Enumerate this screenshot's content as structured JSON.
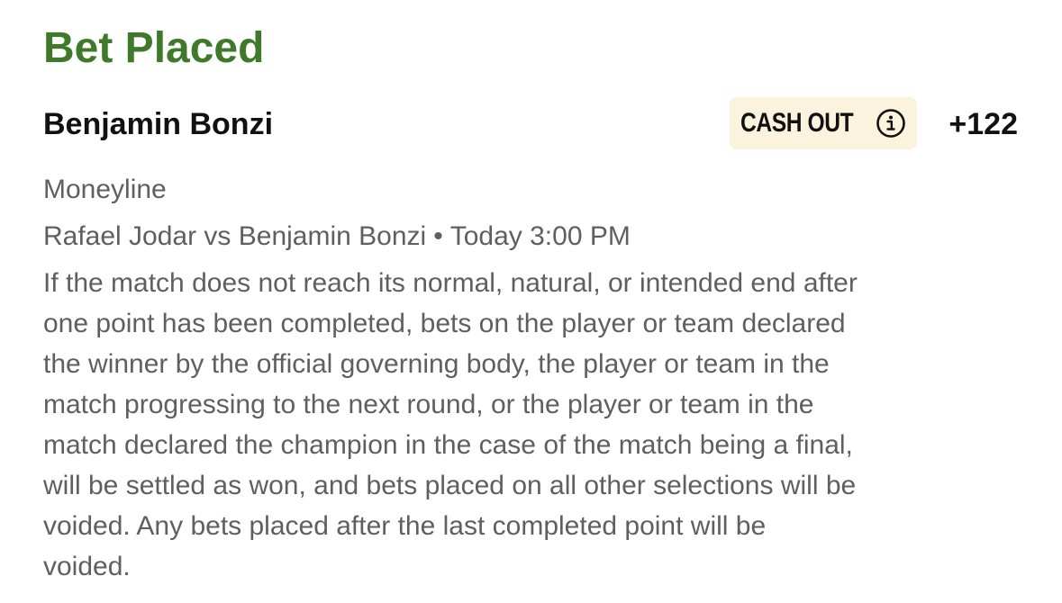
{
  "status_title": "Bet Placed",
  "selection": {
    "name": "Benjamin Bonzi",
    "odds": "+122"
  },
  "cash_out": {
    "label": "CASH OUT",
    "icon": "info-icon"
  },
  "bet_type": "Moneyline",
  "event": {
    "matchup": "Rafael Jodar vs Benjamin Bonzi",
    "separator": "•",
    "time": "Today 3:00 PM"
  },
  "rules_lines": [
    "If the match does not reach its normal, natural, or intended end after",
    "one point has been completed, bets on the player or team declared",
    "the winner by the official governing body, the player or team in the",
    "match progressing to the next round, or the player or team in the",
    "match declared the champion in the case of the match being a final,",
    "will be settled as won, and bets placed on all other selections will be",
    "voided. Any bets placed after the last completed point will be",
    "voided."
  ],
  "colors": {
    "status_green": "#3f7a2b",
    "cash_out_bg": "#fbf3dd",
    "primary_text": "#111111",
    "secondary_text": "#5f5f5f"
  }
}
